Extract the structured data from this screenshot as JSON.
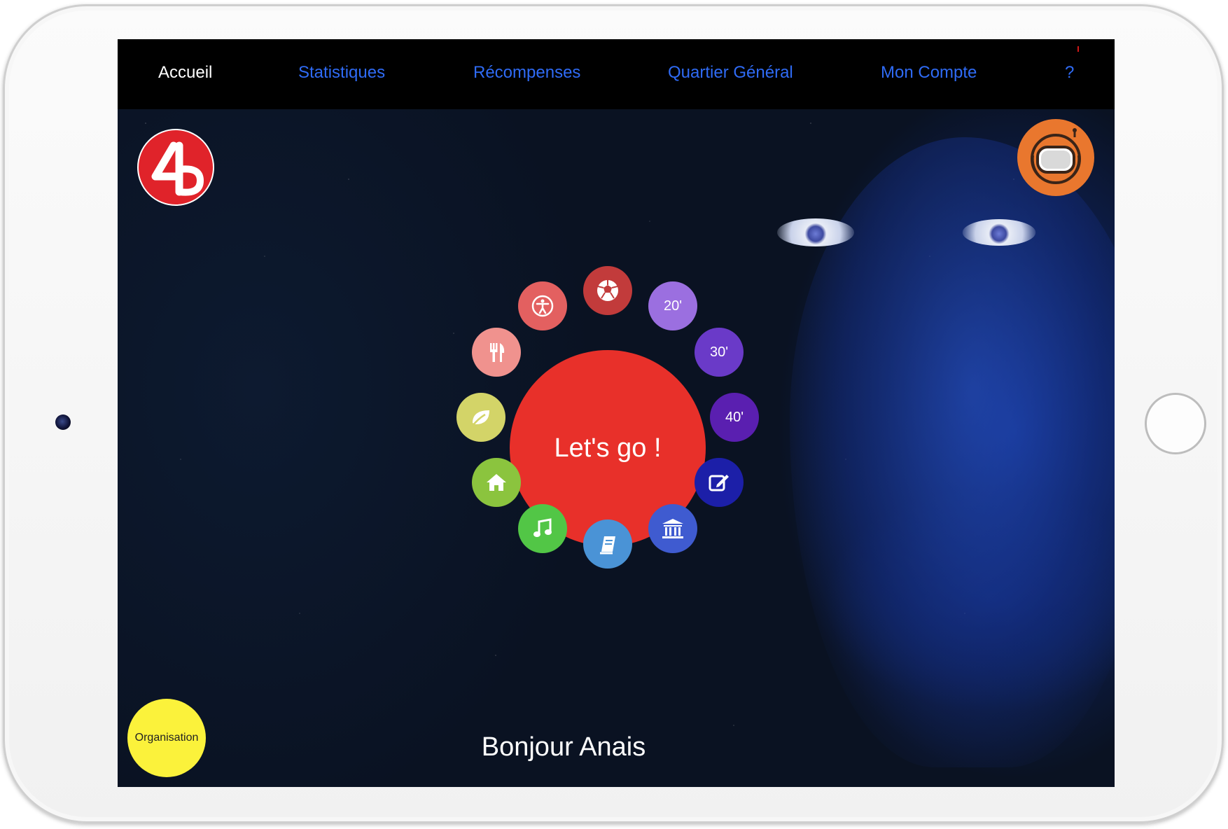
{
  "nav": {
    "items": [
      {
        "label": "Accueil",
        "active": true
      },
      {
        "label": "Statistiques",
        "active": false
      },
      {
        "label": "Récompenses",
        "active": false
      },
      {
        "label": "Quartier Général",
        "active": false
      },
      {
        "label": "Mon Compte",
        "active": false
      },
      {
        "label": "?",
        "active": false
      }
    ],
    "active_color": "#ffffff",
    "link_color": "#2f6bf5"
  },
  "logo": {
    "text": "4b",
    "color": "#e0232a"
  },
  "profile": {
    "icon": "astronaut-helmet-icon",
    "color": "#e9772e"
  },
  "wheel": {
    "center_label": "Let's go !",
    "center_color": "#e8302a",
    "petals": [
      {
        "name": "soccer-ball-icon",
        "color": "#c23b3b"
      },
      {
        "name": "20",
        "label": "20'",
        "color": "#9b6fe0"
      },
      {
        "name": "30",
        "label": "30'",
        "color": "#6a3ac8"
      },
      {
        "name": "40",
        "label": "40'",
        "color": "#5a1fb0"
      },
      {
        "name": "edit-icon",
        "color": "#1c1fa8"
      },
      {
        "name": "museum-icon",
        "color": "#3f5bd0"
      },
      {
        "name": "book-icon",
        "color": "#4a93d6"
      },
      {
        "name": "music-icon",
        "color": "#52c646"
      },
      {
        "name": "home-icon",
        "color": "#8bc43e"
      },
      {
        "name": "leaf-icon",
        "color": "#d3d468"
      },
      {
        "name": "fork-knife-icon",
        "color": "#f0928e"
      },
      {
        "name": "accessibility-icon",
        "color": "#e36060"
      }
    ]
  },
  "organisation_button": {
    "label": "Organisation",
    "color": "#fbf23b"
  },
  "greeting": "Bonjour Anais"
}
